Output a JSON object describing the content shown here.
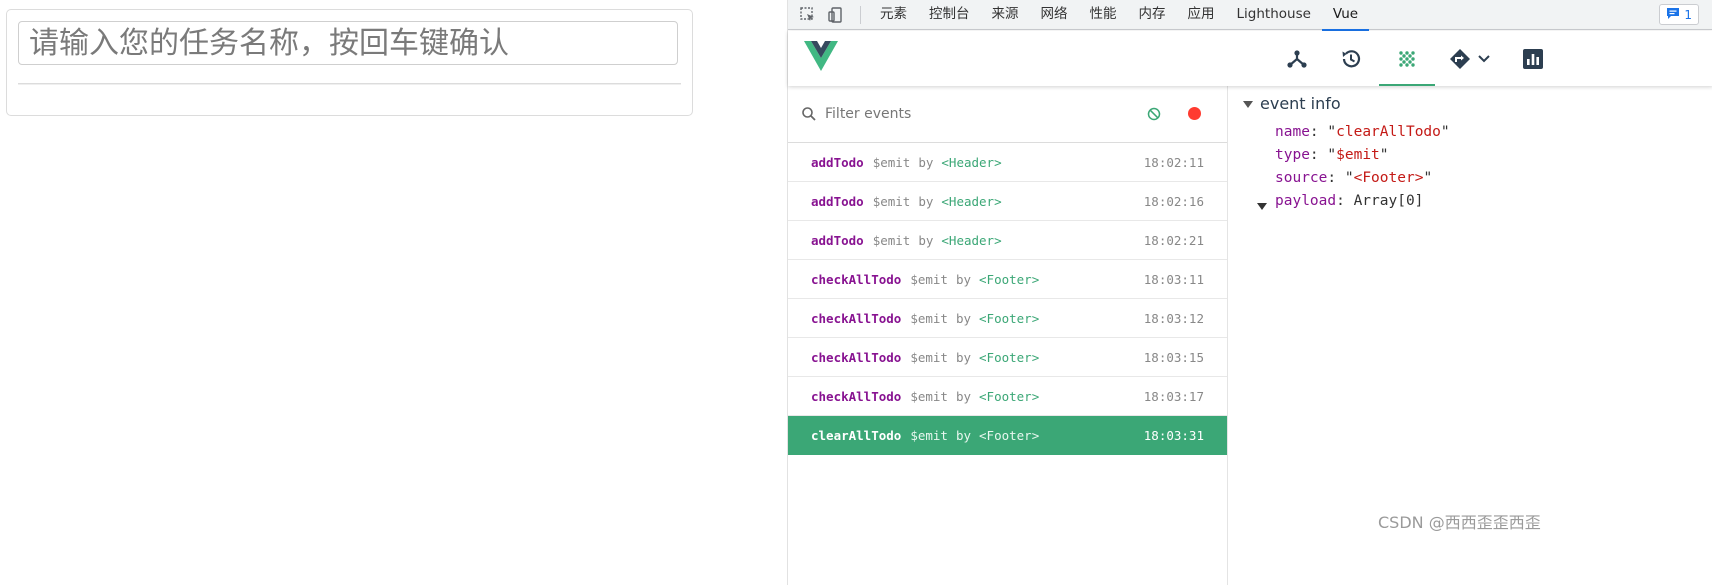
{
  "app": {
    "input_placeholder": "请输入您的任务名称，按回车键确认"
  },
  "devtools": {
    "tabs": [
      "元素",
      "控制台",
      "来源",
      "网络",
      "性能",
      "内存",
      "应用",
      "Lighthouse",
      "Vue"
    ],
    "active_tab": "Vue",
    "issues_count": "1",
    "accent_color": "#1a73e8"
  },
  "vue": {
    "nav_buttons": [
      "components-icon",
      "timeline-icon",
      "events-icon",
      "routing-icon",
      "performance-icon"
    ],
    "active_nav": "events-icon",
    "accent_color": "#3ba776",
    "filter_placeholder": "Filter events",
    "by_label": "by",
    "events": [
      {
        "name": "addTodo",
        "type": "$emit",
        "by": "by",
        "component": "<Header>",
        "time": "18:02:11"
      },
      {
        "name": "addTodo",
        "type": "$emit",
        "by": "by",
        "component": "<Header>",
        "time": "18:02:16"
      },
      {
        "name": "addTodo",
        "type": "$emit",
        "by": "by",
        "component": "<Header>",
        "time": "18:02:21"
      },
      {
        "name": "checkAllTodo",
        "type": "$emit",
        "by": "by",
        "component": "<Footer>",
        "time": "18:03:11"
      },
      {
        "name": "checkAllTodo",
        "type": "$emit",
        "by": "by",
        "component": "<Footer>",
        "time": "18:03:12"
      },
      {
        "name": "checkAllTodo",
        "type": "$emit",
        "by": "by",
        "component": "<Footer>",
        "time": "18:03:15"
      },
      {
        "name": "checkAllTodo",
        "type": "$emit",
        "by": "by",
        "component": "<Footer>",
        "time": "18:03:17"
      },
      {
        "name": "clearAllTodo",
        "type": "$emit",
        "by": "by",
        "component": "<Footer>",
        "time": "18:03:31"
      }
    ],
    "selected_index": 7,
    "event_info": {
      "title": "event info",
      "name_key": "name",
      "name_value": "clearAllTodo",
      "type_key": "type",
      "type_value": "$emit",
      "source_key": "source",
      "source_value": "<Footer>",
      "payload_key": "payload",
      "payload_value": "Array[0]"
    }
  },
  "watermark": "CSDN @西西歪歪西歪"
}
